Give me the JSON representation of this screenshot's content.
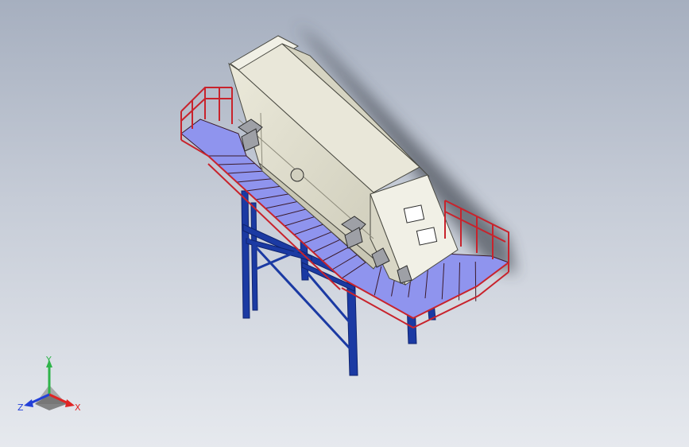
{
  "viewport": {
    "background_top": "#a6afbf",
    "background_bottom": "#e6e9ee"
  },
  "model": {
    "colors": {
      "structure": "#1b3aa3",
      "structure_dark": "#0f2470",
      "railing": "#c8232c",
      "deck": "#8f94ee",
      "grating": "#3a1a2a",
      "housing": "#e1dfce",
      "housing_shade": "#c9c7b4",
      "housing_light": "#f1f0e6",
      "edges": "#4a4a42"
    }
  },
  "triad": {
    "y_label": "Y",
    "x_label": "X",
    "z_label": "Z",
    "y_color": "#2fb44a",
    "x_color": "#e02424",
    "z_color": "#2340d8"
  }
}
